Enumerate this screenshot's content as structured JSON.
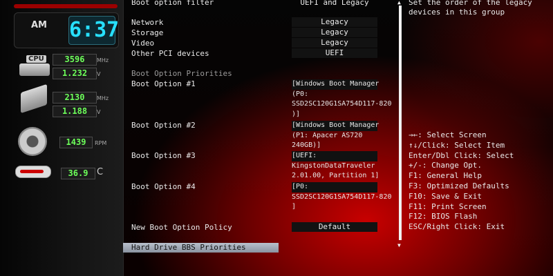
{
  "left_panel": {
    "clock": {
      "ampm": "AM",
      "time": "6:37"
    },
    "cpu": {
      "label": "CPU",
      "freq": "3596",
      "freq_unit": "MHz",
      "volt": "1.232",
      "volt_unit": "V"
    },
    "memory": {
      "freq": "2130",
      "freq_unit": "MHz",
      "volt": "1.188",
      "volt_unit": "V"
    },
    "fan": {
      "rpm": "1439",
      "unit": "RPM"
    },
    "temperature": {
      "value": "36.9",
      "unit": "C"
    }
  },
  "main": {
    "filter": {
      "label": "Boot option filter",
      "value": "UEFI and Legacy"
    },
    "device_rows": [
      {
        "label": "Network",
        "value": "Legacy"
      },
      {
        "label": "Storage",
        "value": "Legacy"
      },
      {
        "label": "Video",
        "value": "Legacy"
      },
      {
        "label": "Other PCI devices",
        "value": "UEFI"
      }
    ],
    "priorities_heading": "Boot Option Priorities",
    "boot_options": [
      {
        "label": "Boot Option #1",
        "lines": [
          "[Windows Boot Manager",
          "(P0:",
          "SSD2SC120G1SA754D117-820",
          ")]"
        ]
      },
      {
        "label": "Boot Option #2",
        "lines": [
          "[Windows Boot Manager",
          "(P1: Apacer AS720",
          "240GB)]"
        ]
      },
      {
        "label": "Boot Option #3",
        "lines": [
          "[UEFI:",
          "KingstonDataTraveler",
          "2.01.00, Partition 1]"
        ]
      },
      {
        "label": "Boot Option #4",
        "lines": [
          "[P0:",
          "SSD2SC120G1SA754D117-820",
          "]"
        ]
      }
    ],
    "new_policy": {
      "label": "New Boot Option Policy",
      "value": "Default"
    },
    "selected_item": "Hard Drive BBS Priorities"
  },
  "help": {
    "description": [
      "Set the order of the legacy",
      "devices in this group"
    ],
    "keys": [
      "→←: Select Screen",
      "↑↓/Click: Select Item",
      "Enter/Dbl Click: Select",
      "+/-: Change Opt.",
      "F1: General Help",
      "F3: Optimized Defaults",
      "F10: Save & Exit",
      "F11: Print Screen",
      "F12: BIOS Flash",
      "ESC/Right Click: Exit"
    ]
  }
}
